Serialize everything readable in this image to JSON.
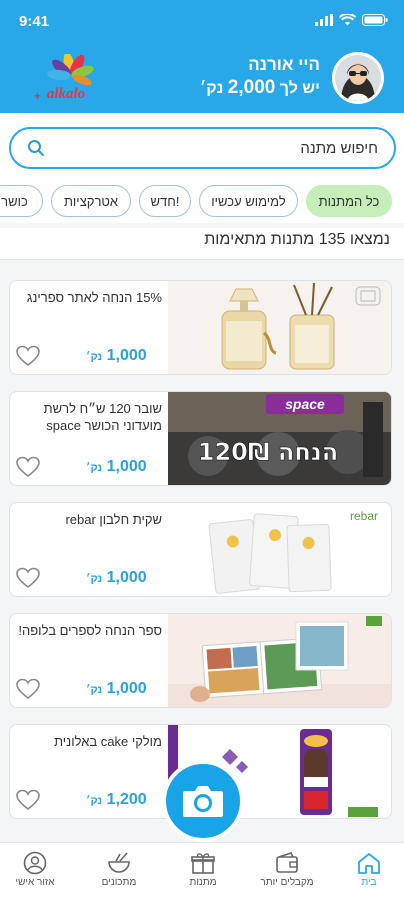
{
  "status": {
    "time": "9:41"
  },
  "header": {
    "greeting": "היי אורנה",
    "balance_prefix": "יש לך",
    "balance_amount": "2,000",
    "balance_unit": "נק׳",
    "logo_text": "alkalo"
  },
  "search": {
    "placeholder": "חיפוש מתנה"
  },
  "chips": [
    {
      "label": "כל המתנות",
      "active": true
    },
    {
      "label": "למימוש עכשיו"
    },
    {
      "label": "חדש!"
    },
    {
      "label": "אטרקציות"
    },
    {
      "label": "כושר"
    }
  ],
  "results_text": "נמצאו 135 מתנות מתאימות",
  "cards": [
    {
      "title": "15% הנחה לאתר ספרינג",
      "price": "1,000",
      "unit": "נק׳"
    },
    {
      "title": "שובר 120 ש״ח לרשת מועדוני הכושר space",
      "price": "1,000",
      "unit": "נק׳",
      "img_brand": "space",
      "img_text": "120₪ הנחה"
    },
    {
      "title": "שקית חלבון rebar",
      "price": "1,000",
      "unit": "נק׳",
      "img_brand": "rebar"
    },
    {
      "title": "ספר הנחה לספרים בלופה!",
      "price": "1,000",
      "unit": "נק׳"
    },
    {
      "title": "מולקי cake באלונית",
      "price": "1,200",
      "unit": "נק׳"
    }
  ],
  "nav": [
    {
      "label": "בית",
      "active": true,
      "icon": "home-icon"
    },
    {
      "label": "מקבלים יותר",
      "icon": "wallet-icon"
    },
    {
      "label": "מתנות",
      "icon": "gift-icon"
    },
    {
      "label": "מתכונים",
      "icon": "bowl-icon"
    },
    {
      "label": "אזור אישי",
      "icon": "user-icon"
    }
  ],
  "colors": {
    "primary": "#29a8e9",
    "chip_active": "#c6eeb9",
    "price": "#2aa1e0"
  }
}
